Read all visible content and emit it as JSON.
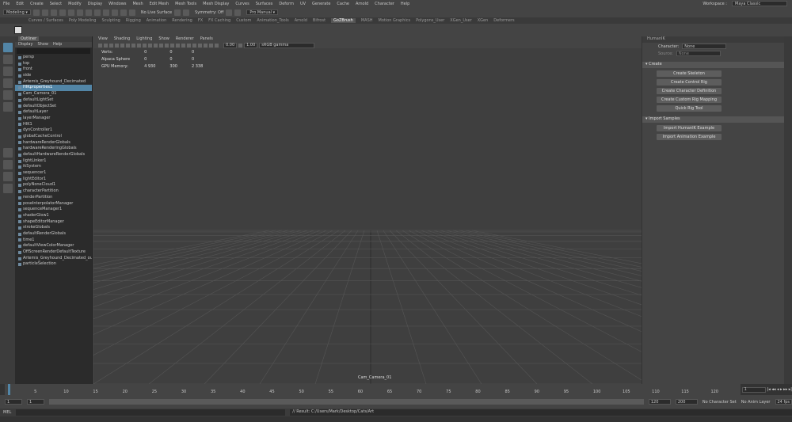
{
  "menubar": {
    "items": [
      "File",
      "Edit",
      "Create",
      "Select",
      "Modify",
      "Display",
      "Windows",
      "Mesh",
      "Edit Mesh",
      "Mesh Tools",
      "Mesh Display",
      "Curves",
      "Surfaces",
      "Deform",
      "UV",
      "Generate",
      "Cache",
      "Arnold",
      "Character",
      "Help"
    ],
    "workspace_label": "Workspace :",
    "workspace_value": "Maya Classic"
  },
  "statusline": {
    "mode": "Modeling",
    "no_live_surface": "No Live Surface",
    "symmetry": "Symmetry: Off",
    "renderer": "Pro Manual"
  },
  "shelf_tabs": [
    "Curves / Surfaces",
    "Poly Modeling",
    "Sculpting",
    "Rigging",
    "Animation",
    "Rendering",
    "FX",
    "FX Caching",
    "Custom",
    "Animation_Tools",
    "Arnold",
    "Bifrost",
    "GoZBrush",
    "MASH",
    "Motion Graphics",
    "Polygons_User",
    "XGen_User",
    "XGen",
    "Deformers"
  ],
  "shelf_active_index": 12,
  "outliner": {
    "tab": "Outliner",
    "menu": [
      "Display",
      "Show",
      "Help"
    ],
    "rows": [
      {
        "label": "persp",
        "selected": false
      },
      {
        "label": "top",
        "selected": false
      },
      {
        "label": "front",
        "selected": false
      },
      {
        "label": "side",
        "selected": false
      },
      {
        "label": "Artemis_Greyhound_Decimated",
        "selected": false
      },
      {
        "label": "HIKproperties1",
        "selected": true
      },
      {
        "label": "Cam_Camera_01",
        "selected": false
      },
      {
        "label": "defaultLightSet",
        "selected": false
      },
      {
        "label": "defaultObjectSet",
        "selected": false
      },
      {
        "label": "defaultLayer",
        "selected": false
      },
      {
        "label": "layerManager",
        "selected": false
      },
      {
        "label": "HIK1",
        "selected": false
      },
      {
        "label": "dynController1",
        "selected": false
      },
      {
        "label": "globalCacheControl",
        "selected": false
      },
      {
        "label": "hardwareRenderGlobals",
        "selected": false
      },
      {
        "label": "hardwareRenderingGlobals",
        "selected": false
      },
      {
        "label": "defaultHardwareRenderGlobals",
        "selected": false
      },
      {
        "label": "lightLinker1",
        "selected": false
      },
      {
        "label": "ikSystem",
        "selected": false
      },
      {
        "label": "sequencer1",
        "selected": false
      },
      {
        "label": "lightEditor1",
        "selected": false
      },
      {
        "label": "polyNoneCloud1",
        "selected": false
      },
      {
        "label": "characterPartition",
        "selected": false
      },
      {
        "label": "renderPartition",
        "selected": false
      },
      {
        "label": "poseInterpolatorManager",
        "selected": false
      },
      {
        "label": "sequenceManager1",
        "selected": false
      },
      {
        "label": "shaderGlow1",
        "selected": false
      },
      {
        "label": "shapeEditorManager",
        "selected": false
      },
      {
        "label": "strokeGlobals",
        "selected": false
      },
      {
        "label": "defaultRenderGlobals",
        "selected": false
      },
      {
        "label": "time1",
        "selected": false
      },
      {
        "label": "defaultViewColorManager",
        "selected": false
      },
      {
        "label": "OffScreenRenderDefaultTexture",
        "selected": false
      },
      {
        "label": "Artemis_Greyhound_Decimated_out1",
        "selected": false
      },
      {
        "label": "particleSelection",
        "selected": false
      }
    ]
  },
  "viewport": {
    "menu": [
      "View",
      "Shading",
      "Lighting",
      "Show",
      "Renderer",
      "Panels"
    ],
    "exposure": "0.00",
    "gamma": "1.00",
    "colorspace": "sRGB gamma",
    "hud": [
      {
        "label": "Verts:",
        "a": "0",
        "b": "0",
        "c": "0"
      },
      {
        "label": "Alpaca Sphere",
        "a": "0",
        "b": "0",
        "c": "0"
      },
      {
        "label": "GPU Memory:",
        "a": "4 930",
        "b": "300",
        "c": "2 338"
      }
    ],
    "camera_name": "Cam_Camera_01"
  },
  "attribute_panel": {
    "title": "HumanIK",
    "character_label": "Character:",
    "character_value": "None",
    "source_label": "Source:",
    "source_value": "None",
    "section_create": "Create",
    "create_buttons": [
      "Create Skeleton",
      "Create Control Rig",
      "Create Character Definition",
      "Create Custom Rig Mapping",
      "Quick Rig Tool"
    ],
    "section_import": "Import Samples",
    "import_buttons": [
      "Import HumanIK Example",
      "Import Animation Example"
    ]
  },
  "timeslider": {
    "ticks": [
      "5",
      "10",
      "15",
      "20",
      "25",
      "30",
      "35",
      "40",
      "45",
      "50",
      "55",
      "60",
      "65",
      "70",
      "75",
      "80",
      "85",
      "90",
      "95",
      "100",
      "105",
      "110",
      "115",
      "120"
    ],
    "current_frame": "1"
  },
  "range": {
    "start": "1",
    "end": "120",
    "anim_end": "200",
    "no_character_set": "No Character Set",
    "no_anim_layer": "No Anim Layer",
    "fps": "24 fps"
  },
  "cmdline": {
    "lang": "MEL",
    "result": "// Result: C:/Users/Mark/Desktop/Cats/Art"
  },
  "colors": {
    "accent": "#5285a6",
    "maya_logo": "#1dc3cf"
  }
}
